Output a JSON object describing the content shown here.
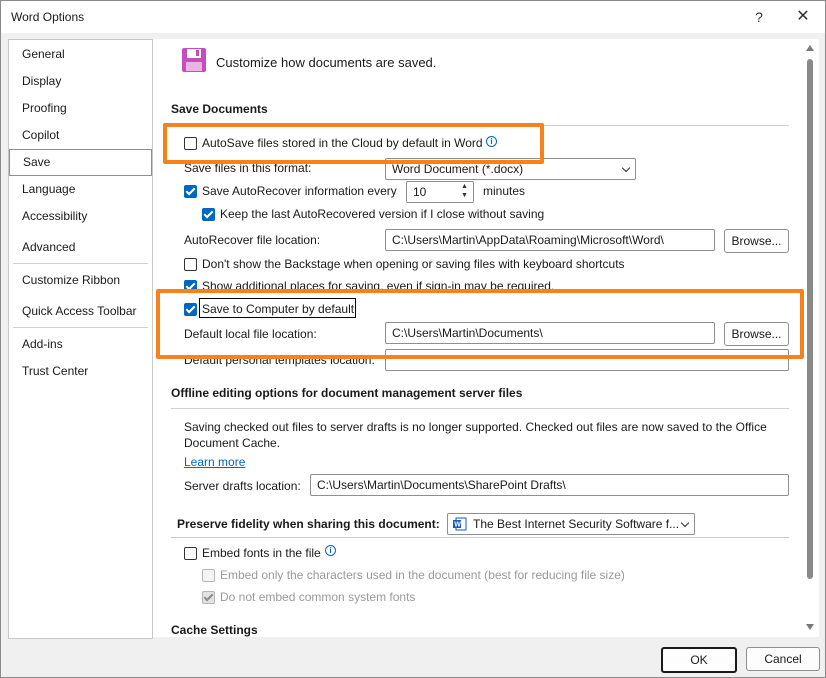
{
  "window": {
    "title": "Word Options",
    "help": "?",
    "close": "✕"
  },
  "sidebar": {
    "items": [
      {
        "label": "General"
      },
      {
        "label": "Display"
      },
      {
        "label": "Proofing"
      },
      {
        "label": "Copilot"
      },
      {
        "label": "Save",
        "active": true
      },
      {
        "label": "Language"
      },
      {
        "label": "Accessibility"
      },
      {
        "label": "Advanced"
      },
      {
        "label": "Customize Ribbon"
      },
      {
        "label": "Quick Access Toolbar"
      },
      {
        "label": "Add-ins"
      },
      {
        "label": "Trust Center"
      }
    ]
  },
  "header": {
    "text": "Customize how documents are saved."
  },
  "save_documents": {
    "heading": "Save Documents",
    "autosave_label": "AutoSave files stored in the Cloud by default in Word",
    "autosave_checked": false,
    "format_label": "Save files in this format:",
    "format_value": "Word Document (*.docx)",
    "autorecover_label": "Save AutoRecover information every",
    "autorecover_checked": true,
    "autorecover_minutes": "10",
    "minutes_label": "minutes",
    "keep_label": "Keep the last AutoRecovered version if I close without saving",
    "keep_checked": true,
    "ar_location_label": "AutoRecover file location:",
    "ar_location_value": "C:\\Users\\Martin\\AppData\\Roaming\\Microsoft\\Word\\",
    "browse_label": "Browse...",
    "backstage_label": "Don't show the Backstage when opening or saving files with keyboard shortcuts",
    "backstage_checked": false,
    "additional_label": "Show additional places for saving, even if sign-in may be required.",
    "additional_checked": true,
    "save_computer_label": "Save to Computer by default",
    "save_computer_checked": true,
    "default_location_label": "Default local file location:",
    "default_location_value": "C:\\Users\\Martin\\Documents\\",
    "templates_label": "Default personal templates location:"
  },
  "offline": {
    "heading": "Offline editing options for document management server files",
    "description": "Saving checked out files to server drafts is no longer supported. Checked out files are now saved to the Office",
    "description2": "Document Cache.",
    "learn_more": "Learn more",
    "drafts_label": "Server drafts location:",
    "drafts_value": "C:\\Users\\Martin\\Documents\\SharePoint Drafts\\"
  },
  "fidelity": {
    "heading": "Preserve fidelity when sharing this document:",
    "document_value": "The Best Internet Security Software f...",
    "embed_label": "Embed fonts in the file",
    "embed_checked": false,
    "embed_only_label": "Embed only the characters used in the document (best for reducing file size)",
    "embed_only_checked": false,
    "no_common_label": "Do not embed common system fonts",
    "no_common_checked": true
  },
  "cache": {
    "heading": "Cache Settings"
  },
  "footer": {
    "ok": "OK",
    "cancel": "Cancel"
  },
  "colors": {
    "accent": "#0067c0",
    "highlight": "#f7821b",
    "save_icon": "#c74dbf"
  },
  "icons": {
    "save": "floppy-disk-icon",
    "info": "info-icon",
    "word_doc": "word-document-icon"
  }
}
